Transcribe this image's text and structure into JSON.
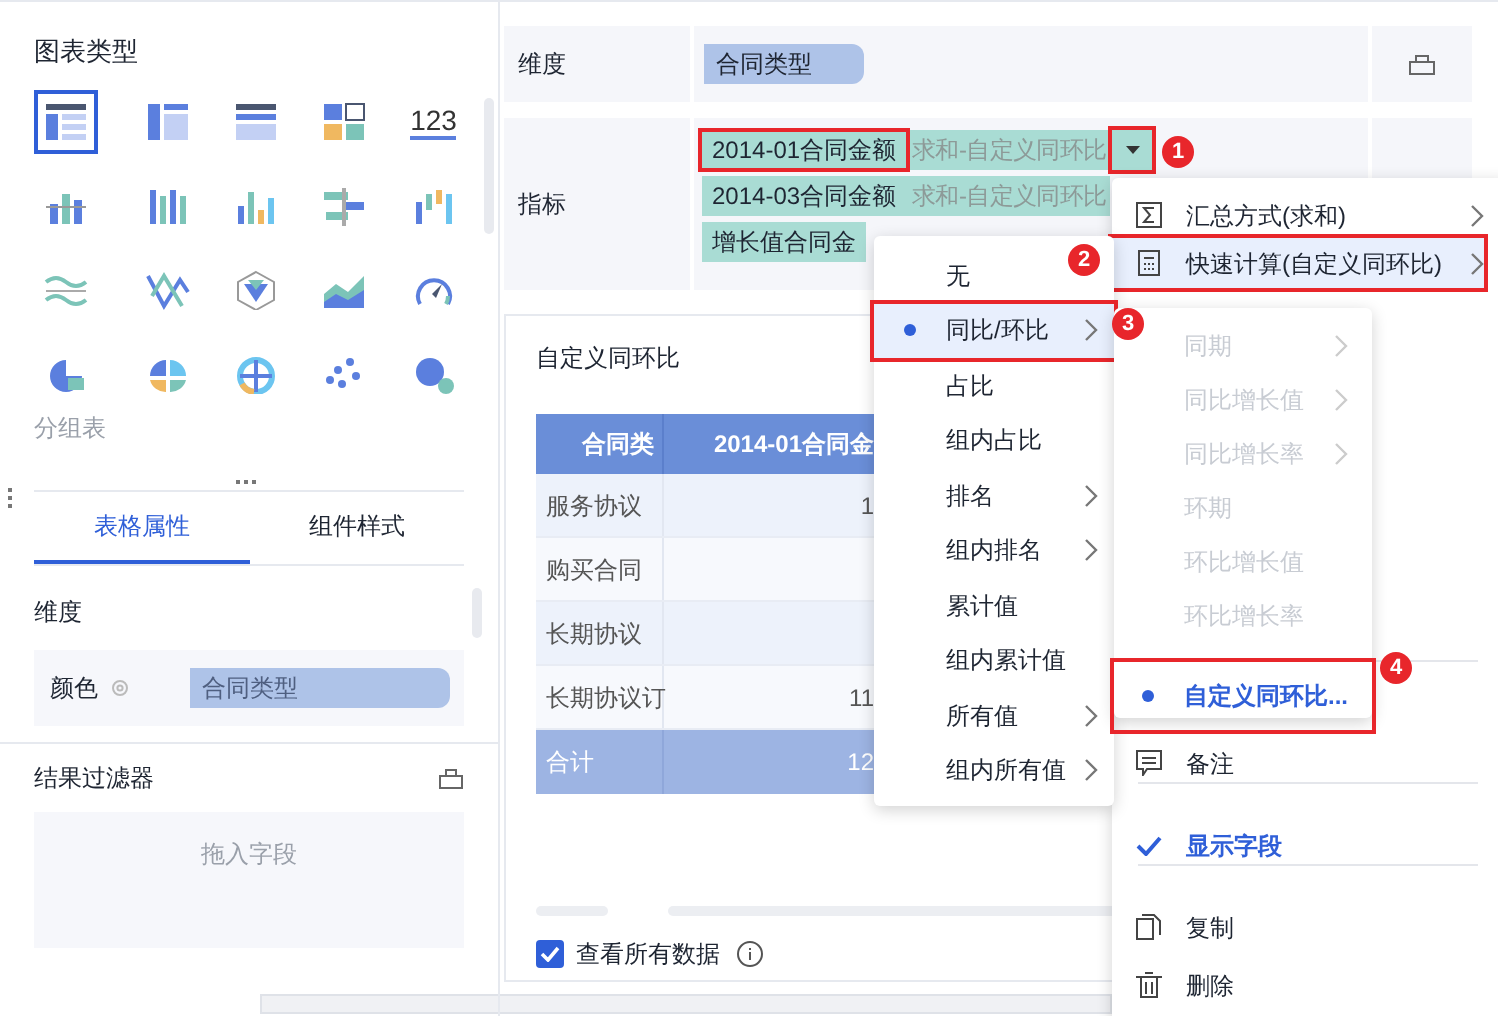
{
  "chart_types": {
    "title": "图表类型",
    "items": [
      {
        "selected": true
      },
      {
        "selected": false
      },
      {
        "selected": false
      },
      {
        "selected": false
      },
      {
        "selected": false,
        "label": "123"
      },
      {
        "selected": false
      },
      {
        "selected": false
      },
      {
        "selected": false
      },
      {
        "selected": false
      },
      {
        "selected": false
      },
      {
        "selected": false
      },
      {
        "selected": false
      },
      {
        "selected": false
      },
      {
        "selected": false
      },
      {
        "selected": false
      },
      {
        "selected": false
      },
      {
        "selected": false
      },
      {
        "selected": false
      },
      {
        "selected": false
      },
      {
        "selected": false
      }
    ],
    "current": "分组表"
  },
  "tabs": [
    {
      "label": "表格属性",
      "selected": true
    },
    {
      "label": "组件样式",
      "selected": false
    }
  ],
  "properties": {
    "section": "维度",
    "rows": [
      {
        "label": "颜色",
        "field": "合同类型"
      }
    ]
  },
  "result_filter": {
    "title": "结果过滤器",
    "placeholder": "拖入字段"
  },
  "dimension": {
    "label": "维度",
    "fields": [
      "合同类型"
    ]
  },
  "measures": {
    "label": "指标",
    "fields": [
      {
        "name": "2014-01合同金额",
        "summary": "求和-自定义同环比",
        "highlighted": true,
        "dropdown": true
      },
      {
        "name": "2014-03合同金额",
        "summary": "求和-自定义同环比",
        "highlighted": false,
        "dropdown": false
      },
      {
        "name": "增长值合同金",
        "highlighted": false,
        "dropdown": false
      }
    ]
  },
  "widget": {
    "title": "自定义同环比",
    "table": {
      "columns": [
        "合同类",
        "2014-01合同金"
      ],
      "rows": [
        {
          "name": "服务协议",
          "value": "1"
        },
        {
          "name": "购买合同"
        },
        {
          "name": "长期协议"
        },
        {
          "name": "长期协议订",
          "value": "11"
        }
      ],
      "total": {
        "name": "合计",
        "value": "12"
      }
    },
    "show_all": {
      "label": "查看所有数据",
      "checked": true
    }
  },
  "field_menu": {
    "items": [
      {
        "label": "汇总方式(求和)",
        "submenu": true,
        "highlighted": false,
        "checked": false
      },
      {
        "label": "快速计算(自定义同环比)",
        "submenu": true,
        "highlighted": true,
        "checked": false
      },
      {
        "label": "备注",
        "submenu": false,
        "highlighted": false,
        "checked": false
      },
      {
        "label": "显示字段",
        "submenu": false,
        "highlighted": false,
        "checked": true
      },
      {
        "label": "复制",
        "submenu": false,
        "highlighted": false,
        "checked": false
      },
      {
        "label": "删除",
        "submenu": false,
        "highlighted": false,
        "checked": false
      }
    ]
  },
  "quick_calc_menu": {
    "items": [
      {
        "label": "无",
        "submenu": false,
        "selected": false,
        "highlighted": false
      },
      {
        "label": "同比/环比",
        "submenu": true,
        "selected": true,
        "highlighted": true
      },
      {
        "label": "占比",
        "submenu": false,
        "selected": false,
        "highlighted": false
      },
      {
        "label": "组内占比",
        "submenu": false,
        "selected": false,
        "highlighted": false
      },
      {
        "label": "排名",
        "submenu": true,
        "selected": false,
        "highlighted": false
      },
      {
        "label": "组内排名",
        "submenu": true,
        "selected": false,
        "highlighted": false
      },
      {
        "label": "累计值",
        "submenu": false,
        "selected": false,
        "highlighted": false
      },
      {
        "label": "组内累计值",
        "submenu": false,
        "selected": false,
        "highlighted": false
      },
      {
        "label": "所有值",
        "submenu": true,
        "selected": false,
        "highlighted": false
      },
      {
        "label": "组内所有值",
        "submenu": true,
        "selected": false,
        "highlighted": false
      }
    ]
  },
  "compare_menu": {
    "items": [
      {
        "label": "同期",
        "submenu": true,
        "disabled": true,
        "selected": false,
        "highlighted": false
      },
      {
        "label": "同比增长值",
        "submenu": true,
        "disabled": true,
        "selected": false,
        "highlighted": false
      },
      {
        "label": "同比增长率",
        "submenu": true,
        "disabled": true,
        "selected": false,
        "highlighted": false
      },
      {
        "label": "环期",
        "submenu": false,
        "disabled": true,
        "selected": false,
        "highlighted": false
      },
      {
        "label": "环比增长值",
        "submenu": false,
        "disabled": true,
        "selected": false,
        "highlighted": false
      },
      {
        "label": "环比增长率",
        "submenu": false,
        "disabled": true,
        "selected": false,
        "highlighted": false
      },
      {
        "label": "自定义同环比...",
        "submenu": false,
        "disabled": false,
        "selected": true,
        "highlighted": true
      }
    ]
  },
  "step_markers": [
    "1",
    "2",
    "3",
    "4"
  ]
}
